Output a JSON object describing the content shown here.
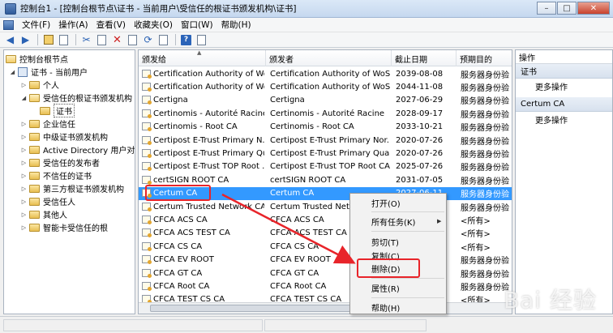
{
  "window": {
    "title": "控制台1 - [控制台根节点\\证书 - 当前用户\\受信任的根证书颁发机构\\证书]",
    "controls": {
      "minimize": "–",
      "maximize": "□",
      "close": "✕"
    }
  },
  "menubar": {
    "items": [
      "文件(F)",
      "操作(A)",
      "查看(V)",
      "收藏夹(O)",
      "窗口(W)",
      "帮助(H)"
    ]
  },
  "toolbar": {
    "buttons": [
      "back-icon",
      "forward-icon",
      "up-folder-icon",
      "console-tree-icon",
      "cut-icon",
      "copy-icon",
      "delete-icon",
      "properties-icon",
      "refresh-icon",
      "export-icon",
      "help-icon",
      "view-icon"
    ]
  },
  "tree": {
    "items": [
      {
        "label": "控制台根节点",
        "expander": ""
      },
      {
        "label": "证书 - 当前用户",
        "expander": "◢"
      },
      {
        "label": "个人",
        "expander": "▷"
      },
      {
        "label": "受信任的根证书颁发机构",
        "expander": "◢"
      },
      {
        "label": "证书",
        "expander": ""
      },
      {
        "label": "企业信任",
        "expander": "▷"
      },
      {
        "label": "中级证书颁发机构",
        "expander": "▷"
      },
      {
        "label": "Active Directory 用户对象",
        "expander": "▷"
      },
      {
        "label": "受信任的发布者",
        "expander": "▷"
      },
      {
        "label": "不信任的证书",
        "expander": "▷"
      },
      {
        "label": "第三方根证书颁发机构",
        "expander": "▷"
      },
      {
        "label": "受信任人",
        "expander": "▷"
      },
      {
        "label": "其他人",
        "expander": "▷"
      },
      {
        "label": "智能卡受信任的根",
        "expander": "▷"
      }
    ]
  },
  "list": {
    "columns": [
      "颁发给",
      "颁发者",
      "截止日期",
      "预期目的"
    ],
    "rows": [
      {
        "issued_to": "Certification Authority of Wo...",
        "issuer": "Certification Authority of WoSi...",
        "expires": "2039-08-08",
        "purpose": "服务器身份验"
      },
      {
        "issued_to": "Certification Authority of Wo...",
        "issuer": "Certification Authority of WoSi...",
        "expires": "2044-11-08",
        "purpose": "服务器身份验"
      },
      {
        "issued_to": "Certigna",
        "issuer": "Certigna",
        "expires": "2027-06-29",
        "purpose": "服务器身份验"
      },
      {
        "issued_to": "Certinomis - Autorité Racine",
        "issuer": "Certinomis - Autorité Racine",
        "expires": "2028-09-17",
        "purpose": "服务器身份验"
      },
      {
        "issued_to": "Certinomis - Root CA",
        "issuer": "Certinomis - Root CA",
        "expires": "2033-10-21",
        "purpose": "服务器身份验"
      },
      {
        "issued_to": "Certipost E-Trust Primary N...",
        "issuer": "Certipost E-Trust Primary Nor...",
        "expires": "2020-07-26",
        "purpose": "服务器身份验"
      },
      {
        "issued_to": "Certipost E-Trust Primary Qu...",
        "issuer": "Certipost E-Trust Primary Qual...",
        "expires": "2020-07-26",
        "purpose": "服务器身份验"
      },
      {
        "issued_to": "Certipost E-Trust TOP Root ...",
        "issuer": "Certipost E-Trust TOP Root CA",
        "expires": "2025-07-26",
        "purpose": "服务器身份验"
      },
      {
        "issued_to": "certSIGN ROOT CA",
        "issuer": "certSIGN ROOT CA",
        "expires": "2031-07-05",
        "purpose": "服务器身份验"
      },
      {
        "issued_to": "Certum CA",
        "issuer": "Certum CA",
        "expires": "2027-06-11",
        "purpose": "服务器身份验"
      },
      {
        "issued_to": "Certum Trusted Network CA",
        "issuer": "Certum Trusted Netwo...",
        "expires": "",
        "purpose": "服务器身份验"
      },
      {
        "issued_to": "CFCA ACS CA",
        "issuer": "CFCA ACS CA",
        "expires": "",
        "purpose": "<所有>"
      },
      {
        "issued_to": "CFCA ACS TEST CA",
        "issuer": "CFCA ACS TEST CA",
        "expires": "",
        "purpose": "<所有>"
      },
      {
        "issued_to": "CFCA CS CA",
        "issuer": "CFCA CS CA",
        "expires": "",
        "purpose": "<所有>"
      },
      {
        "issued_to": "CFCA EV ROOT",
        "issuer": "CFCA EV ROOT",
        "expires": "",
        "purpose": "服务器身份验"
      },
      {
        "issued_to": "CFCA GT CA",
        "issuer": "CFCA GT CA",
        "expires": "",
        "purpose": "服务器身份验"
      },
      {
        "issued_to": "CFCA Root CA",
        "issuer": "CFCA Root CA",
        "expires": "",
        "purpose": "服务器身份验"
      },
      {
        "issued_to": "CFCA TEST CS CA",
        "issuer": "CFCA TEST CS CA",
        "expires": "",
        "purpose": "<所有>"
      }
    ]
  },
  "actions": {
    "title": "操作",
    "groups": [
      {
        "name": "证书",
        "item": "更多操作"
      },
      {
        "name": "Certum CA",
        "item": "更多操作"
      }
    ]
  },
  "context_menu": {
    "items": [
      "打开(O)",
      "所有任务(K)",
      "剪切(T)",
      "复制(C)",
      "删除(D)",
      "属性(R)",
      "帮助(H)"
    ],
    "submenu_arrow": "▶"
  },
  "watermark": "Bai 经验"
}
